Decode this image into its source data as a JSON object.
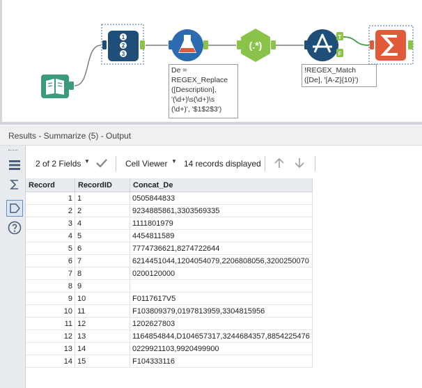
{
  "workflow": {
    "formula_annotation": "De =\nREGEX_Replace\n([Description],\n'(\\d+)\\s(\\d+)\\s\n(\\d+)', '$1$2$3')",
    "filter_annotation": "!REGEX_Match\n([De], '[A-Z]{10}')",
    "filter_true_label": "T",
    "filter_false_label": "F",
    "regex_icon_text": "(.*)",
    "record_icon_digits": [
      "1",
      "2",
      "3"
    ],
    "colors": {
      "input_green": "#3b9b78",
      "record_navy": "#1f4e79",
      "formula_blue": "#2b6cb0",
      "regex_green": "#8bc34a",
      "filter_navy": "#1f4e79",
      "summarize_orange": "#e05a3a",
      "connector_green": "#7fb347"
    }
  },
  "results": {
    "title": "Results - Summarize (5) - Output",
    "fields_label": "2 of 2 Fields",
    "cell_viewer_label": "Cell Viewer",
    "records_label": "14 records displayed",
    "columns": [
      "Record",
      "RecordID",
      "Concat_De"
    ],
    "rows": [
      [
        "1",
        "1",
        "0505844833"
      ],
      [
        "2",
        "2",
        "9234885861,3303569335"
      ],
      [
        "3",
        "4",
        "1111801979"
      ],
      [
        "4",
        "5",
        "4454811589"
      ],
      [
        "5",
        "6",
        "7774736621,8274722644"
      ],
      [
        "6",
        "7",
        "6214451044,1204054079,2206808056,3200250070"
      ],
      [
        "7",
        "8",
        "0200120000"
      ],
      [
        "8",
        "9",
        ""
      ],
      [
        "9",
        "10",
        "F0117617V5"
      ],
      [
        "10",
        "11",
        "F103809379,0197813959,3304815956"
      ],
      [
        "11",
        "12",
        "1202627803"
      ],
      [
        "12",
        "13",
        "1164854844,D104657317,3244684357,8854225476"
      ],
      [
        "13",
        "14",
        "0229921103,9920499900"
      ],
      [
        "14",
        "15",
        "F104333116"
      ]
    ]
  }
}
